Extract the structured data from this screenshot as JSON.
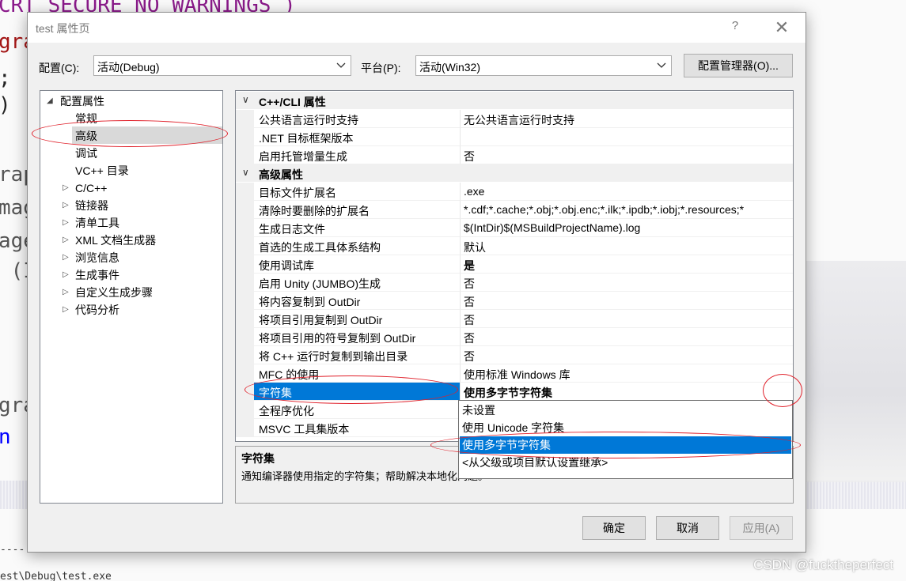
{
  "dialog": {
    "title": "test 属性页",
    "help_glyph": "?",
    "close_glyph": "✕",
    "config_label": "配置(C):",
    "config_value": "活动(Debug)",
    "platform_label": "平台(P):",
    "platform_value": "活动(Win32)",
    "config_manager_button": "配置管理器(O)..."
  },
  "tree": {
    "root": "配置属性",
    "items": [
      {
        "label": "常规",
        "expandable": false
      },
      {
        "label": "高级",
        "expandable": false,
        "selected": true
      },
      {
        "label": "调试",
        "expandable": false
      },
      {
        "label": "VC++ 目录",
        "expandable": false
      },
      {
        "label": "C/C++",
        "expandable": true
      },
      {
        "label": "链接器",
        "expandable": true
      },
      {
        "label": "清单工具",
        "expandable": true
      },
      {
        "label": "XML 文档生成器",
        "expandable": true
      },
      {
        "label": "浏览信息",
        "expandable": true
      },
      {
        "label": "生成事件",
        "expandable": true
      },
      {
        "label": "自定义生成步骤",
        "expandable": true
      },
      {
        "label": "代码分析",
        "expandable": true
      }
    ]
  },
  "grid": {
    "categories": [
      {
        "title": "C++/CLI 属性",
        "rows": [
          {
            "name": "公共语言运行时支持",
            "value": "无公共语言运行时支持"
          },
          {
            "name": ".NET 目标框架版本",
            "value": ""
          },
          {
            "name": "启用托管增量生成",
            "value": "否"
          }
        ]
      },
      {
        "title": "高级属性",
        "rows": [
          {
            "name": "目标文件扩展名",
            "value": ".exe"
          },
          {
            "name": "清除时要删除的扩展名",
            "value": "*.cdf;*.cache;*.obj;*.obj.enc;*.ilk;*.ipdb;*.iobj;*.resources;*"
          },
          {
            "name": "生成日志文件",
            "value": "$(IntDir)$(MSBuildProjectName).log"
          },
          {
            "name": "首选的生成工具体系结构",
            "value": "默认"
          },
          {
            "name": "使用调试库",
            "value": "是"
          },
          {
            "name": "启用 Unity (JUMBO)生成",
            "value": "否"
          },
          {
            "name": "将内容复制到 OutDir",
            "value": "否"
          },
          {
            "name": "将项目引用复制到 OutDir",
            "value": "否"
          },
          {
            "name": "将项目引用的符号复制到 OutDir",
            "value": "否"
          },
          {
            "name": "将 C++ 运行时复制到输出目录",
            "value": "否"
          },
          {
            "name": "MFC 的使用",
            "value": "使用标准 Windows 库"
          },
          {
            "name": "字符集",
            "value": "使用多字节字符集",
            "selected": true
          },
          {
            "name": "全程序优化",
            "value": ""
          },
          {
            "name": "MSVC 工具集版本",
            "value": ""
          }
        ]
      }
    ]
  },
  "dropdown": {
    "options": [
      "未设置",
      "使用 Unicode 字符集",
      "使用多字节字符集",
      "<从父级或项目默认设置继承>"
    ],
    "selected_index": 2
  },
  "description": {
    "title": "字符集",
    "text": "通知编译器使用指定的字符集；帮助解决本地化问题。"
  },
  "buttons": {
    "ok": "确定",
    "cancel": "取消",
    "apply": "应用(A)"
  },
  "background": {
    "code_lines": [
      "CRT_SECURE_NO_WARNINGS )",
      "gra",
      ";",
      ")",
      "rap",
      "mag",
      "age",
      " (I",
      "gra",
      "n ("
    ],
    "output_line": "est\\Debug\\test.exe",
    "separator": "----"
  },
  "watermark": "CSDN @fucktheperfect",
  "colors": {
    "selection": "#0078d7",
    "annotation": "#e0202a",
    "keyword_purple": "#8b1a8b",
    "keyword_red": "#a31515",
    "keyword_blue": "#0000ff"
  }
}
